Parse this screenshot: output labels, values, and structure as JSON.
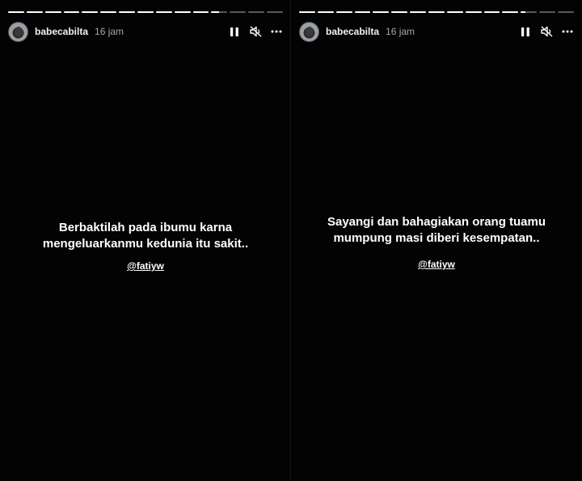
{
  "stories": [
    {
      "username": "babecabilta",
      "time": "16 jam",
      "progress": {
        "segments": 15,
        "completed": 11,
        "current_fill": 0.5
      },
      "caption_lines": [
        "Berbaktilah pada ibumu karna",
        "mengeluarkanmu kedunia itu sakit.."
      ],
      "mention": "@fatiyw"
    },
    {
      "username": "babecabilta",
      "time": "16 jam",
      "progress": {
        "segments": 15,
        "completed": 12,
        "current_fill": 0.3
      },
      "caption_lines": [
        "Sayangi dan bahagiakan orang tuamu",
        "mumpung masi diberi kesempatan.."
      ],
      "mention": "@fatiyw"
    }
  ],
  "icons": {
    "pause": "pause-icon",
    "mute": "speaker-muted-icon",
    "more": "more-options-icon"
  }
}
